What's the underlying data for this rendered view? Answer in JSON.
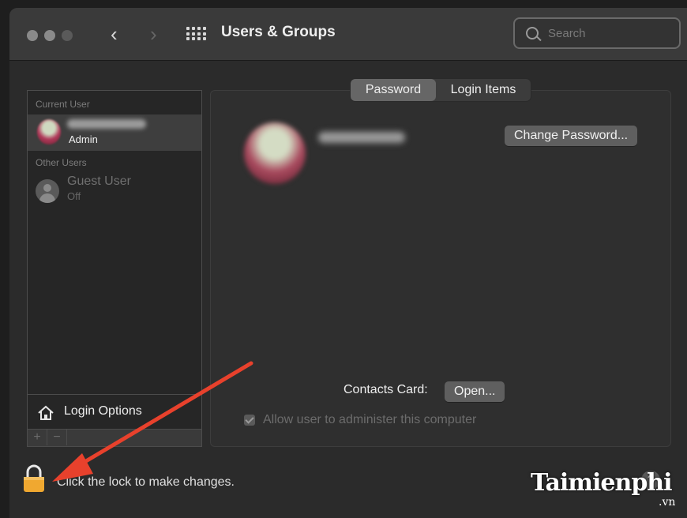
{
  "titlebar": {
    "title": "Users & Groups",
    "search_placeholder": "Search"
  },
  "sidebar": {
    "current_user_header": "Current User",
    "current_user_role": "Admin",
    "other_users_header": "Other Users",
    "guest_name": "Guest User",
    "guest_status": "Off",
    "login_options": "Login Options",
    "add_symbol": "+",
    "remove_symbol": "−"
  },
  "tabs": {
    "password": "Password",
    "login_items": "Login Items",
    "active": "Password"
  },
  "main": {
    "change_password": "Change Password...",
    "contacts_card_label": "Contacts Card:",
    "open_button": "Open...",
    "allow_admin_label": "Allow user to administer this computer",
    "allow_admin_checked": true
  },
  "footer": {
    "lock_text": "Click the lock to make changes.",
    "help_symbol": "?"
  },
  "watermark": {
    "text": "Taimienphi",
    "sub": ".vn"
  },
  "colors": {
    "annotation_arrow": "#e8412c",
    "lock": "#f0a830"
  }
}
